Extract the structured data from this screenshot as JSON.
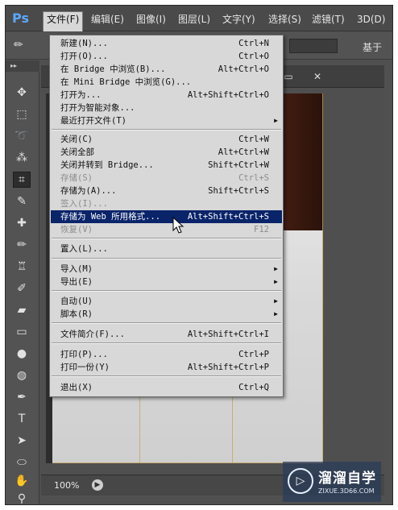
{
  "app": {
    "logo": "Ps"
  },
  "menubar": {
    "items": [
      "文件(F)",
      "编辑(E)",
      "图像(I)",
      "图层(L)",
      "文字(Y)",
      "选择(S)",
      "滤镜(T)",
      "3D(D)"
    ],
    "active": "文件(F)"
  },
  "options_bar": {
    "label": "基于"
  },
  "toolbar": {
    "collapse_glyph": "▸▸",
    "tools": [
      {
        "icon": "move-icon",
        "glyph": "✥"
      },
      {
        "icon": "marquee-icon",
        "glyph": "⬚"
      },
      {
        "icon": "lasso-icon",
        "glyph": "➰"
      },
      {
        "icon": "quick-select-icon",
        "glyph": "⁂"
      },
      {
        "icon": "crop-icon",
        "glyph": "⌗"
      },
      {
        "icon": "eyedropper-icon",
        "glyph": "✎"
      },
      {
        "icon": "healing-brush-icon",
        "glyph": "✚"
      },
      {
        "icon": "brush-icon",
        "glyph": "✏"
      },
      {
        "icon": "clone-stamp-icon",
        "glyph": "♖"
      },
      {
        "icon": "history-brush-icon",
        "glyph": "✐"
      },
      {
        "icon": "eraser-icon",
        "glyph": "▰"
      },
      {
        "icon": "gradient-icon",
        "glyph": "▭"
      },
      {
        "icon": "blur-icon",
        "glyph": "●"
      },
      {
        "icon": "dodge-icon",
        "glyph": "◍"
      },
      {
        "icon": "pen-icon",
        "glyph": "✒"
      },
      {
        "icon": "type-icon",
        "glyph": "T"
      },
      {
        "icon": "path-select-icon",
        "glyph": "➤"
      },
      {
        "icon": "shape-icon",
        "glyph": "⬭"
      },
      {
        "icon": "hand-icon",
        "glyph": "✋"
      },
      {
        "icon": "zoom-icon",
        "glyph": "⚲"
      }
    ]
  },
  "document": {
    "zoom": "100%",
    "window_controls": {
      "restore": "▭",
      "close": "✕"
    }
  },
  "file_menu": {
    "items": [
      {
        "label": "新建(N)...",
        "shortcut": "Ctrl+N"
      },
      {
        "label": "打开(O)...",
        "shortcut": "Ctrl+O"
      },
      {
        "label": "在 Bridge 中浏览(B)...",
        "shortcut": "Alt+Ctrl+O"
      },
      {
        "label": "在 Mini Bridge 中浏览(G)...",
        "shortcut": ""
      },
      {
        "label": "打开为...",
        "shortcut": "Alt+Shift+Ctrl+O"
      },
      {
        "label": "打开为智能对象...",
        "shortcut": ""
      },
      {
        "label": "最近打开文件(T)",
        "shortcut": "",
        "submenu": true
      },
      {
        "label": "关闭(C)",
        "shortcut": "Ctrl+W"
      },
      {
        "label": "关闭全部",
        "shortcut": "Alt+Ctrl+W"
      },
      {
        "label": "关闭并转到 Bridge...",
        "shortcut": "Shift+Ctrl+W"
      },
      {
        "label": "存储(S)",
        "shortcut": "Ctrl+S",
        "disabled": true
      },
      {
        "label": "存储为(A)...",
        "shortcut": "Shift+Ctrl+S"
      },
      {
        "label": "签入(I)...",
        "shortcut": "",
        "disabled": true
      },
      {
        "label": "存储为 Web 所用格式...",
        "shortcut": "Alt+Shift+Ctrl+S",
        "highlighted": true
      },
      {
        "label": "恢复(V)",
        "shortcut": "F12",
        "disabled": true
      },
      {
        "label": "置入(L)...",
        "shortcut": ""
      },
      {
        "label": "导入(M)",
        "shortcut": "",
        "submenu": true
      },
      {
        "label": "导出(E)",
        "shortcut": "",
        "submenu": true
      },
      {
        "label": "自动(U)",
        "shortcut": "",
        "submenu": true
      },
      {
        "label": "脚本(R)",
        "shortcut": "",
        "submenu": true
      },
      {
        "label": "文件简介(F)...",
        "shortcut": "Alt+Shift+Ctrl+I"
      },
      {
        "label": "打印(P)...",
        "shortcut": "Ctrl+P"
      },
      {
        "label": "打印一份(Y)",
        "shortcut": "Alt+Shift+Ctrl+P"
      },
      {
        "label": "退出(X)",
        "shortcut": "Ctrl+Q"
      }
    ]
  },
  "watermark": {
    "logo_glyph": "▷",
    "title": "溜溜自学",
    "subtitle": "ZIXUE.3D66.COM"
  }
}
